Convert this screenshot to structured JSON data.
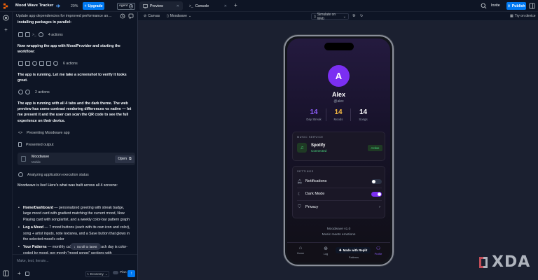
{
  "topbar": {
    "project_name": "Mood Wave Tracker",
    "usage": "20%",
    "upgrade_label": "Upgrade",
    "agent_label": "Agent",
    "agent_count": "4",
    "tabs": [
      {
        "label": "Preview"
      },
      {
        "label": "Console"
      }
    ],
    "invite_label": "Invite",
    "publish_label": "Publish"
  },
  "chat": {
    "title": "Update app dependencies for improved performance an…",
    "messages": [
      "installing packages in parallel:",
      "Now wrapping the app with MoodProvider and starting the workflow:",
      "The app is running. Let me take a screenshot to verify it looks great.",
      "The app is running with all 4 tabs and the dark theme. The web preview has some contrast rendering differences vs native — let me present it and the user can scan the QR code to see the full experience on their device."
    ],
    "action_groups": [
      "4 actions",
      "6 actions",
      "2 actions"
    ],
    "status_items": [
      "Presenting Moodwave app",
      "Presented output",
      "Analyzing application execution status"
    ],
    "app_card": {
      "name": "Moodwave",
      "platform": "Mobile",
      "open_label": "Open"
    },
    "summary": "Moodwave is live! Here's what was built across all 4 screens:",
    "bullets": [
      {
        "title": "Home/Dashboard",
        "text": " — personalized greeting with streak badge, large mood card with gradient matching the current mood, Now Playing card with song/artist, and a weekly color-bar pattern graph"
      },
      {
        "title": "Log a Mood",
        "text": " — 7 mood buttons (each with its own icon and color), song + artist inputs, note textarea, and a Save button that glows in the selected mood's color"
      },
      {
        "title": "Your Patterns",
        "text": " — monthly calendar grid where each day is color-coded by mood, per-month \"mood songs\" sections with"
      }
    ],
    "scroll_label": "Scroll to latest",
    "composer_placeholder": "Make, test, iterate...",
    "mode_label": "Economy",
    "plan_label": "Plan"
  },
  "preview": {
    "canvas_label": "Canvas",
    "app_select": "Moodwave",
    "simulate_label": "Simulate on Web",
    "try_device_label": "Try on device"
  },
  "phone": {
    "avatar_letter": "A",
    "name": "Alex",
    "handle": "@alex",
    "stats": [
      {
        "value": "14",
        "label": "Day Streak",
        "color": "#8b5cf6"
      },
      {
        "value": "14",
        "label": "Moods",
        "color": "#f5b942"
      },
      {
        "value": "14",
        "label": "Songs",
        "color": "#ffffff"
      }
    ],
    "music_header": "MUSIC SERVICE",
    "service_name": "Spotify",
    "service_status": "Connected",
    "service_badge": "Active",
    "settings_header": "SETTINGS",
    "settings": [
      {
        "label": "Notifications",
        "control": "toggle-off"
      },
      {
        "label": "Dark Mode",
        "control": "toggle-on"
      },
      {
        "label": "Privacy",
        "control": "chevron"
      }
    ],
    "version": "Moodwave v1.0",
    "tagline": "Music meets emotions",
    "tabs": [
      {
        "label": "Home",
        "icon": "home-icon"
      },
      {
        "label": "Log",
        "icon": "plus-circle-icon"
      },
      {
        "label": "Patterns",
        "icon": "chart-icon"
      },
      {
        "label": "Profile",
        "icon": "user-icon"
      }
    ],
    "made_with": "Made with Replit"
  },
  "watermark": "XDA",
  "colors": {
    "accent": "#0079f2",
    "purple": "#7b2ff2",
    "green": "#4ade80"
  }
}
